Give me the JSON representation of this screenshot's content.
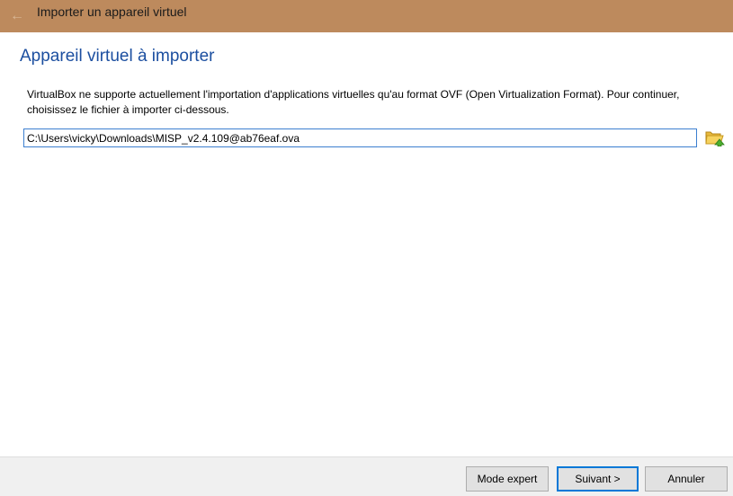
{
  "window": {
    "title": "Importer un appareil virtuel",
    "back_icon": "←"
  },
  "page": {
    "title": "Appareil virtuel à importer",
    "description": "VirtualBox ne supporte actuellement l'importation d'applications virtuelles qu'au format OVF (Open Virtualization Format). Pour continuer, choisissez le fichier à importer ci-dessous."
  },
  "file_selector": {
    "value": "C:\\Users\\vicky\\Downloads\\MISP_v2.4.109@ab76eaf.ova",
    "browse_icon": "folder-open-icon"
  },
  "footer": {
    "expert_label": "Mode expert",
    "next_label": "Suivant >",
    "cancel_label": "Annuler"
  },
  "colors": {
    "titlebar": "#bd8a5d",
    "page_title": "#1c4fa0",
    "focus_border": "#0078d7"
  }
}
